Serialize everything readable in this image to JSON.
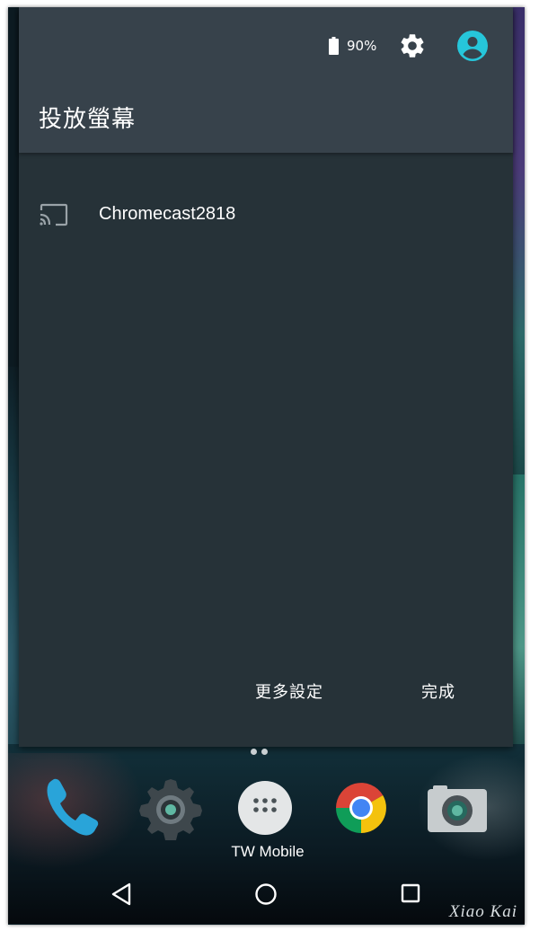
{
  "status_bar": {
    "battery_text": "90%",
    "battery_icon": "battery-icon",
    "settings_icon": "gear-icon",
    "account_icon": "account-circle-icon",
    "accent_color": "#26c6da"
  },
  "panel": {
    "title": "投放螢幕",
    "devices": [
      {
        "icon": "cast-icon",
        "name": "Chromecast2818"
      }
    ],
    "more_settings_label": "更多設定",
    "done_label": "完成",
    "background_color": "#263238",
    "header_color": "#37424b"
  },
  "home_screen": {
    "dock_icons": [
      "phone-icon",
      "settings-app-icon",
      "apps-drawer-icon",
      "chrome-icon",
      "camera-icon"
    ],
    "carrier_label": "TW Mobile"
  },
  "nav_bar": {
    "icons": [
      "back-icon",
      "home-icon",
      "recent-apps-icon"
    ]
  },
  "watermark": "Xiao Kai"
}
